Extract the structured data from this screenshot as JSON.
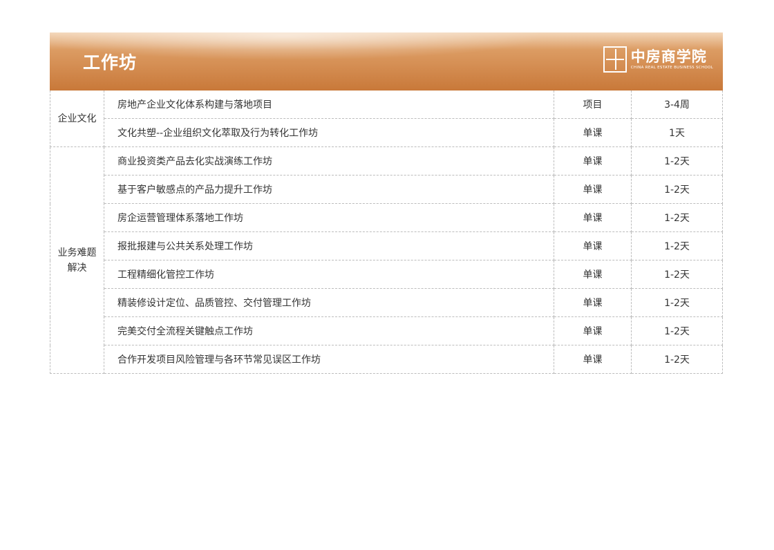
{
  "header": {
    "title": "工作坊",
    "logo": {
      "seal_text": "中房商学院",
      "name": "中房商学院",
      "subtitle": "CHINA REAL ESTATE BUSINESS SCHOOL"
    }
  },
  "table": {
    "groups": [
      {
        "category": "企业文化",
        "rows": [
          {
            "name": "房地产企业文化体系构建与落地项目",
            "type": "项目",
            "duration": "3-4周"
          },
          {
            "name": "文化共塑--企业组织文化萃取及行为转化工作坊",
            "type": "单课",
            "duration": "1天"
          }
        ]
      },
      {
        "category": "业务难题\n解决",
        "rows": [
          {
            "name": "商业投资类产品去化实战演练工作坊",
            "type": "单课",
            "duration": "1-2天"
          },
          {
            "name": "基于客户敏感点的产品力提升工作坊",
            "type": "单课",
            "duration": "1-2天"
          },
          {
            "name": "房企运营管理体系落地工作坊",
            "type": "单课",
            "duration": "1-2天"
          },
          {
            "name": "报批报建与公共关系处理工作坊",
            "type": "单课",
            "duration": "1-2天"
          },
          {
            "name": "工程精细化管控工作坊",
            "type": "单课",
            "duration": "1-2天"
          },
          {
            "name": "精装修设计定位、品质管控、交付管理工作坊",
            "type": "单课",
            "duration": "1-2天"
          },
          {
            "name": "完美交付全流程关键触点工作坊",
            "type": "单课",
            "duration": "1-2天"
          },
          {
            "name": "合作开发项目风险管理与各环节常见误区工作坊",
            "type": "单课",
            "duration": "1-2天"
          }
        ]
      }
    ]
  }
}
